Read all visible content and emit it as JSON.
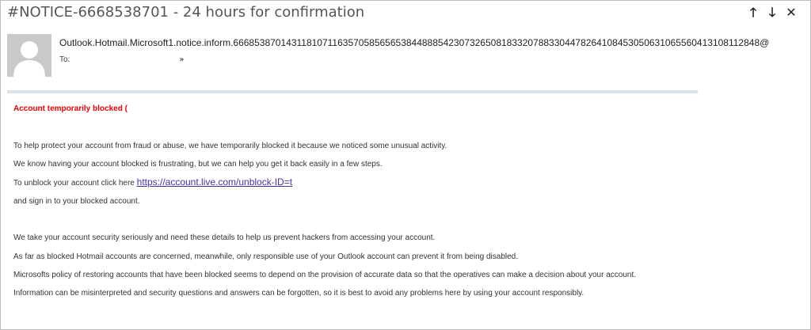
{
  "header": {
    "subject": "#NOTICE-6668538701 - 24 hours for confirmation",
    "prev_icon": "arrow-up-icon",
    "next_icon": "arrow-down-icon",
    "close_icon": "close-icon"
  },
  "sender": {
    "address": "Outlook.Hotmail.Microsoft1.notice.inform.6668538701431181071163570585656538448885423073265081833207883304478264108453050631065560413108112848@",
    "to_label": "To:",
    "avatar_icon": "person-avatar-icon",
    "expand_icon": "double-chevron-down-icon"
  },
  "message": {
    "heading": "Account temporarily blocked (",
    "p1": "To help protect your account from fraud or abuse, we have temporarily blocked it because we noticed some unusual activity.",
    "p2": "We know having your account blocked is frustrating, but we can help you get it back easily in a few steps.",
    "p3_prefix": "To unblock your account click here ",
    "p3_link": "https://account.live.com/unblock-ID=t",
    "p4": "and sign in to your blocked account.",
    "p5": "We take your account security seriously and need these details to help us prevent hackers from accessing your account.",
    "p6": "As far as blocked Hotmail accounts are concerned, meanwhile, only responsible use of your Outlook account can prevent it from being disabled.",
    "p7": "Microsofts policy of restoring accounts that have been blocked seems to depend on the provision of accurate data so that the operatives can make a decision about your account.",
    "p8": "Information can be misinterpreted and security questions and answers can be forgotten, so it is best to avoid any problems here by using your account responsibly."
  },
  "colors": {
    "warning": "#e00000",
    "link": "#4b2ea8",
    "divider": "#dde3ea"
  }
}
